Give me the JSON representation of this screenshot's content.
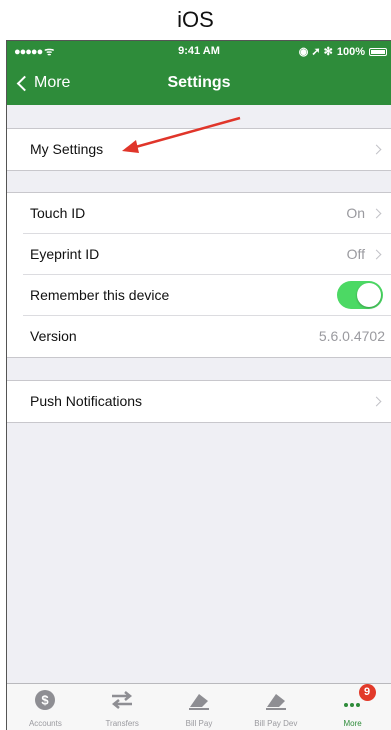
{
  "caption": "iOS",
  "status_bar": {
    "signal": "●●●●● ᯤ",
    "time": "9:41 AM",
    "right_icons": "◉ ➚ ✻",
    "battery": "100%"
  },
  "nav": {
    "back_label": "More",
    "title": "Settings"
  },
  "group1": [
    {
      "label": "My Settings"
    }
  ],
  "group2": [
    {
      "label": "Touch ID",
      "value": "On"
    },
    {
      "label": "Eyeprint ID",
      "value": "Off"
    },
    {
      "label": "Remember this device",
      "toggle": true
    },
    {
      "label": "Version",
      "value": "5.6.0.4702"
    }
  ],
  "group3": [
    {
      "label": "Push Notifications"
    }
  ],
  "tabs": [
    {
      "label": "Accounts",
      "icon": "dollar-circle-icon"
    },
    {
      "label": "Transfers",
      "icon": "transfer-arrows-icon"
    },
    {
      "label": "Bill Pay",
      "icon": "bill-pay-icon"
    },
    {
      "label": "Bill Pay Dev",
      "icon": "bill-pay-icon"
    },
    {
      "label": "More",
      "icon": "more-dots-icon",
      "active": true,
      "badge": "9"
    }
  ],
  "colors": {
    "navbar": "#2e8c3a",
    "toggle_on": "#4cd964",
    "annotation_arrow": "#e0352a",
    "badge": "#e23a2a"
  }
}
